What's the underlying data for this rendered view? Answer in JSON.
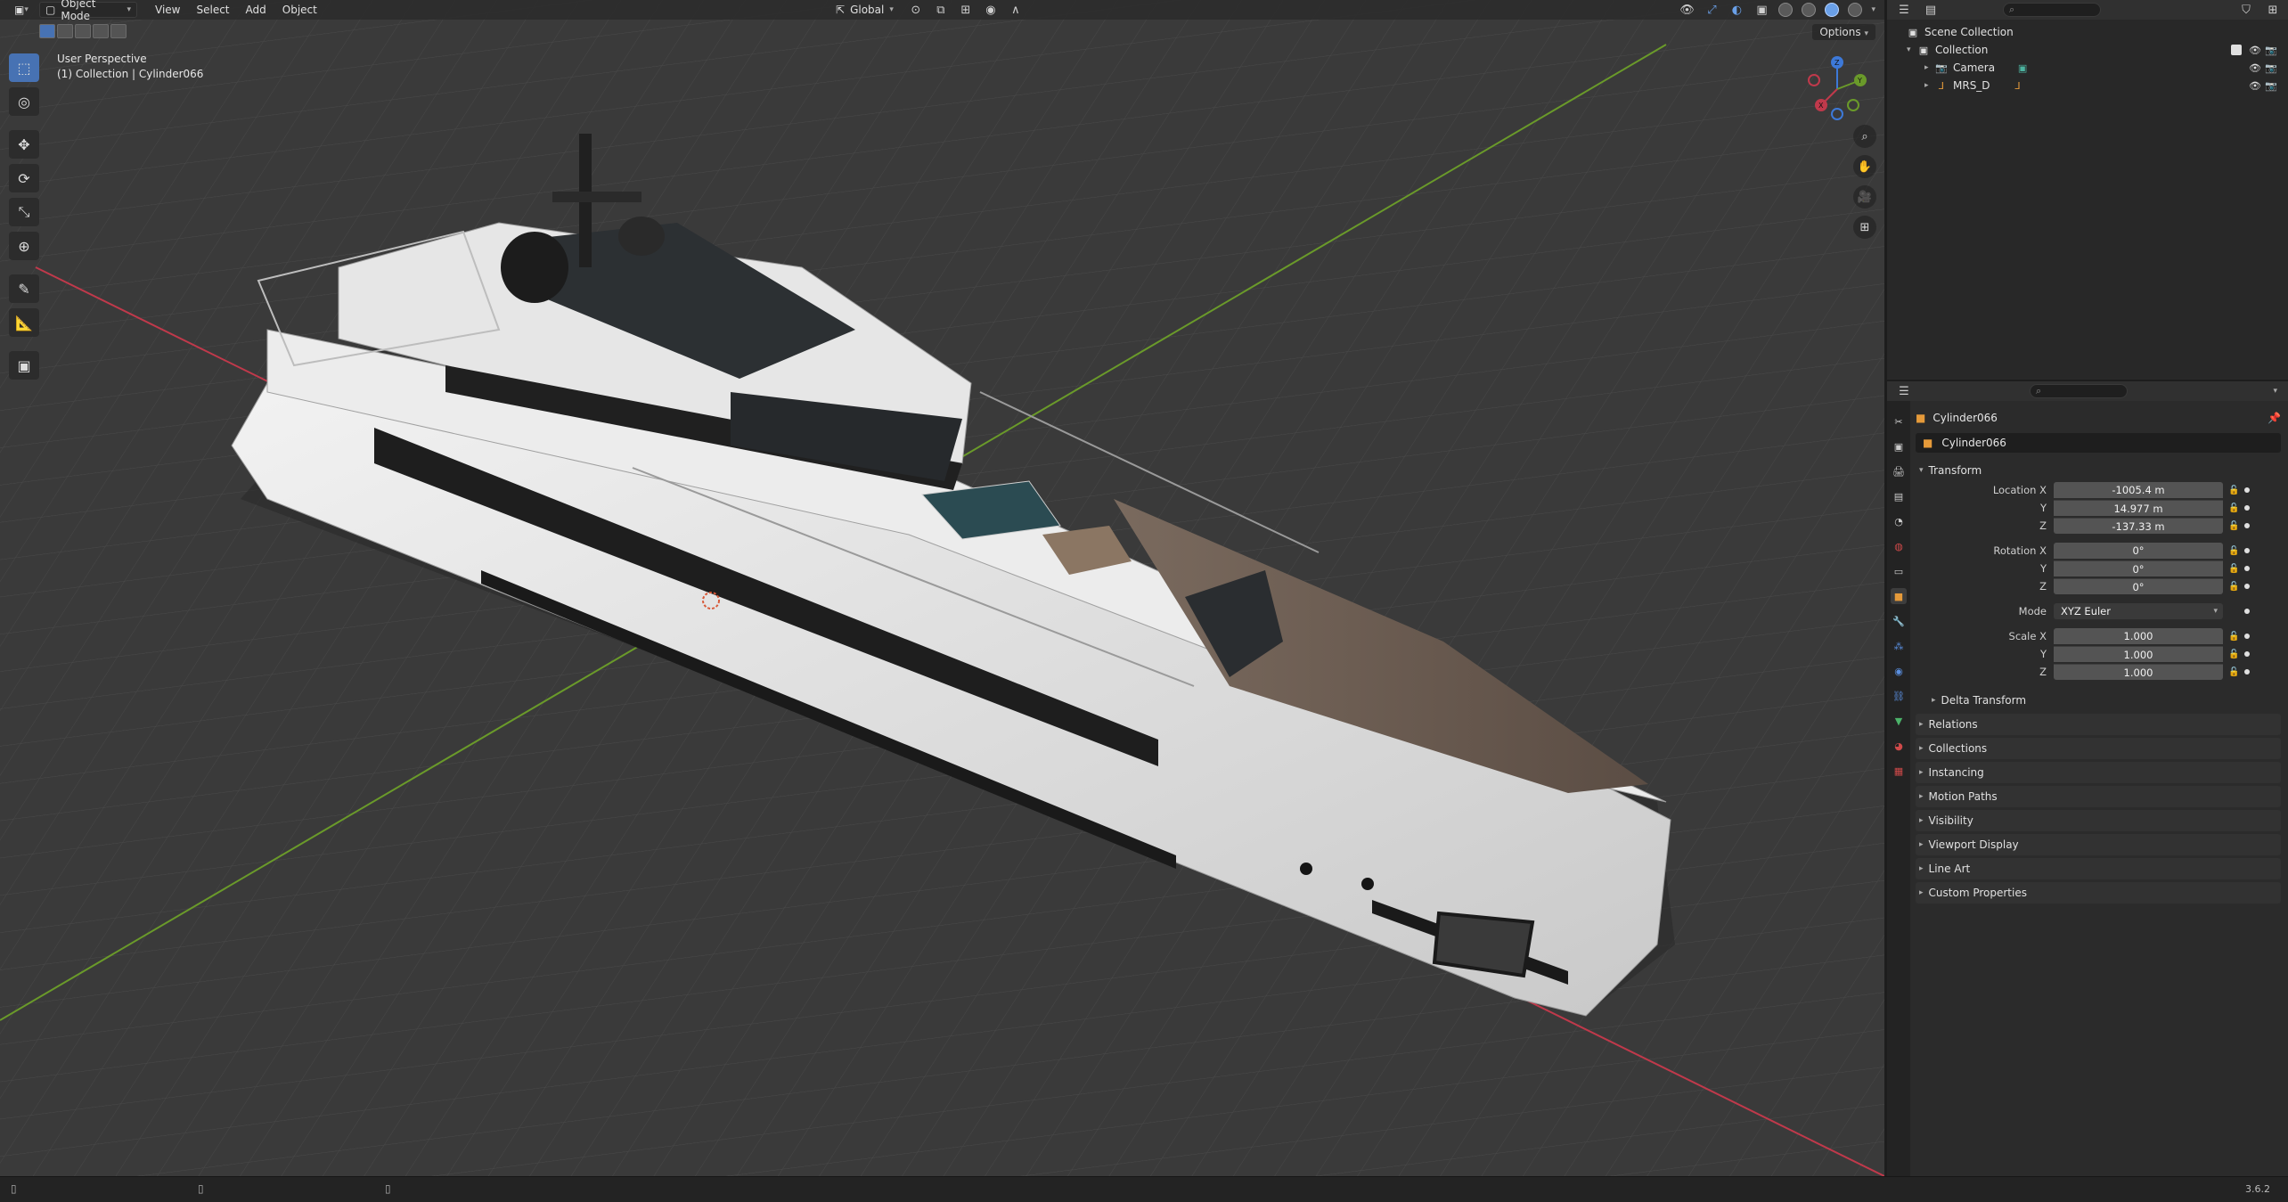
{
  "viewport": {
    "mode_label": "Object Mode",
    "menus": [
      "View",
      "Select",
      "Add",
      "Object"
    ],
    "orientation_label": "Global",
    "options_label": "Options",
    "info_line1": "User Perspective",
    "info_line2": "(1) Collection | Cylinder066",
    "tools": [
      "select-box-icon",
      "cursor-icon",
      "move-icon",
      "rotate-icon",
      "scale-icon",
      "transform-icon",
      "annotate-icon",
      "measure-icon",
      "add-cube-icon"
    ],
    "nav": [
      "zoom-icon",
      "pan-hand-icon",
      "camera-view-icon",
      "ortho-grid-icon"
    ],
    "gizmo_axes": [
      "X",
      "Y",
      "Z"
    ]
  },
  "outliner": {
    "scene_collection": "Scene Collection",
    "collection": "Collection",
    "items": [
      {
        "name": "Camera"
      },
      {
        "name": "MRS_D"
      }
    ]
  },
  "properties": {
    "object_title": "Cylinder066",
    "object_name": "Cylinder066",
    "transform_label": "Transform",
    "location": {
      "label": "Location X",
      "x": "-1005.4 m",
      "y": "14.977 m",
      "z": "-137.33 m"
    },
    "rotation": {
      "label": "Rotation X",
      "x": "0°",
      "y": "0°",
      "z": "0°"
    },
    "mode": {
      "label": "Mode",
      "value": "XYZ Euler"
    },
    "scale": {
      "label": "Scale X",
      "x": "1.000",
      "y": "1.000",
      "z": "1.000"
    },
    "axis_y": "Y",
    "axis_z": "Z",
    "delta_transform": "Delta Transform",
    "panels": [
      "Relations",
      "Collections",
      "Instancing",
      "Motion Paths",
      "Visibility",
      "Viewport Display",
      "Line Art",
      "Custom Properties"
    ]
  },
  "statusbar": {
    "version": "3.6.2"
  },
  "colors": {
    "accent": "#4772b3",
    "axis_x": "#c0394b",
    "axis_y": "#6a9a2a",
    "axis_z": "#3d79d8"
  }
}
